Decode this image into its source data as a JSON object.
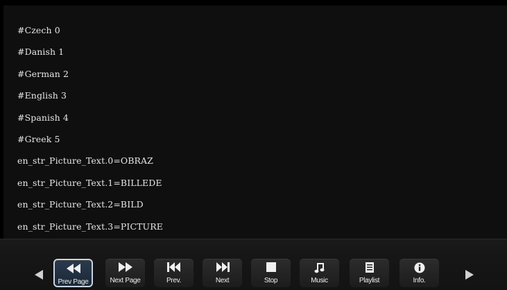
{
  "lines": [
    "#Czech 0",
    "#Danish 1",
    "#German 2",
    "#English 3",
    "#Spanish 4",
    "#Greek 5",
    "en_str_Picture_Text.0=OBRAZ",
    "en_str_Picture_Text.1=BILLEDE",
    "en_str_Picture_Text.2=BILD",
    "en_str_Picture_Text.3=PICTURE"
  ],
  "toolbar": {
    "buttons": [
      {
        "label": "Prev Page",
        "icon": "rewind-icon",
        "selected": true
      },
      {
        "label": "Next Page",
        "icon": "fast-forward-icon",
        "selected": false
      },
      {
        "label": "Prev.",
        "icon": "skip-back-icon",
        "selected": false
      },
      {
        "label": "Next",
        "icon": "skip-forward-icon",
        "selected": false
      },
      {
        "label": "Stop",
        "icon": "stop-icon",
        "selected": false
      },
      {
        "label": "Music",
        "icon": "music-note-icon",
        "selected": false
      },
      {
        "label": "Playlist",
        "icon": "playlist-icon",
        "selected": false
      },
      {
        "label": "Info.",
        "icon": "info-icon",
        "selected": false
      }
    ],
    "scroll_left_icon": "triangle-left-icon",
    "scroll_right_icon": "triangle-right-icon"
  },
  "colors": {
    "background": "#0f0f0f",
    "text": "#e6e6e6",
    "selected_border": "#c7d4e3"
  }
}
